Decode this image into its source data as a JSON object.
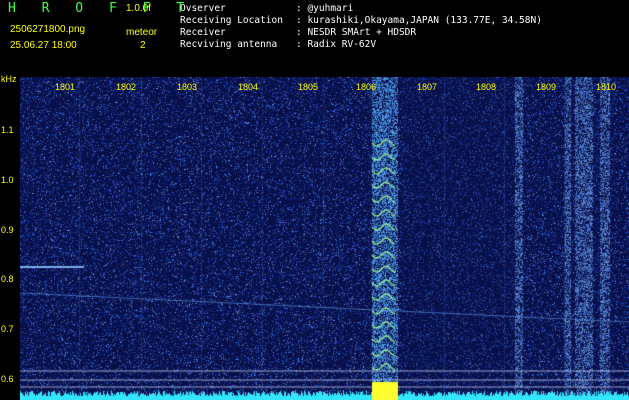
{
  "header": {
    "logo": "H R O F F T",
    "version": "1.0.0f",
    "filename": "2506271800.png",
    "meteor_label": "meteor",
    "datetime": "25.06.27 18:00",
    "meteor_count": "2"
  },
  "info": [
    {
      "label": "Ovserver",
      "value": ": @yuhmari"
    },
    {
      "label": "Receiving Location",
      "value": ": kurashiki,Okayama,JAPAN (133.77E, 34.58N)"
    },
    {
      "label": "Receiver",
      "value": ": NESDR SMArt + HDSDR"
    },
    {
      "label": "Recviving antenna",
      "value": ": Radix RV-62V"
    }
  ],
  "axis": {
    "unit": "kHz",
    "time_ticks": [
      "1801",
      "1802",
      "1803",
      "1804",
      "1805",
      "1806",
      "1807",
      "1808",
      "1809",
      "1810"
    ],
    "freq_ticks": [
      "1.1",
      "1.0",
      "0.9",
      "0.8",
      "0.7",
      "0.6"
    ]
  },
  "colors": {
    "logo": "#3cff3c",
    "labels": "#ffff00",
    "info_text": "#ffffff",
    "background_noise": "#0a1060",
    "noise_bright": "#3aa0ff",
    "signal": "#ffff30"
  }
}
